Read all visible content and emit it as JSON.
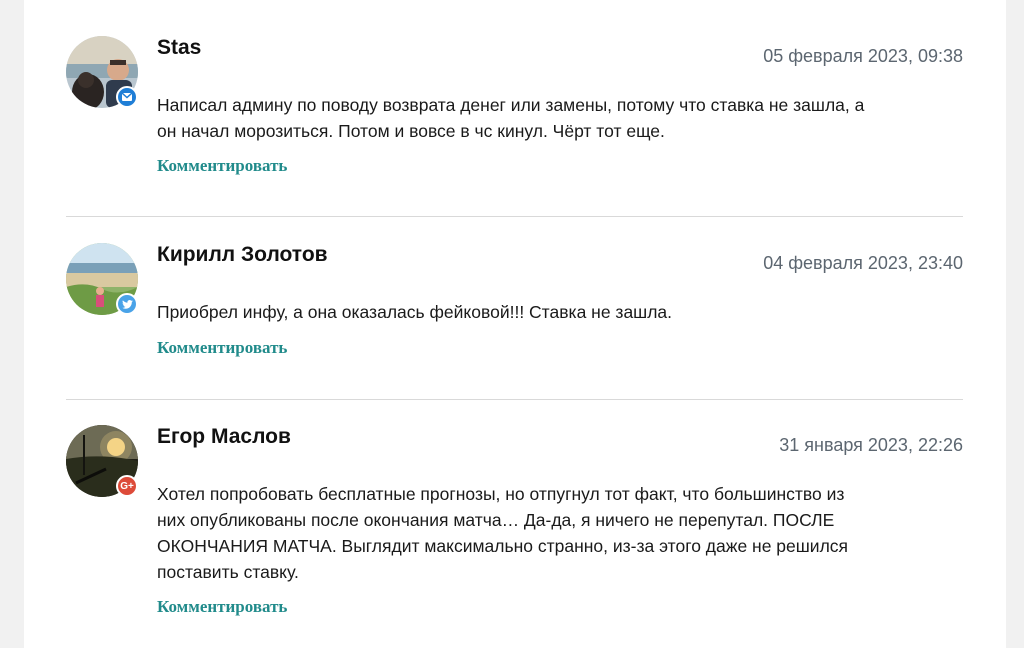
{
  "comments": [
    {
      "author": "Stas",
      "date": "05 февраля 2023, 09:38",
      "text": "Написал админу по поводу возврата денег или замены, потому что ставка не зашла, а он начал морозиться. Потом и вовсе в чс кинул. Чёрт тот еще.",
      "reply_label": "Комментировать",
      "social_icon": "mail-icon",
      "social_color": "#1f7ed6"
    },
    {
      "author": "Кирилл Золотов",
      "date": "04 февраля 2023, 23:40",
      "text": "Приобрел инфу, а она оказалась фейковой!!! Ставка не зашла.",
      "reply_label": "Комментировать",
      "social_icon": "twitter-icon",
      "social_color": "#4aa3e8"
    },
    {
      "author": "Егор Маслов",
      "date": "31 января 2023, 22:26",
      "text": "Хотел попробовать бесплатные прогнозы, но отпугнул тот факт, что большинство из них опубликованы после окончания матча… Да-да, я ничего не перепутал. ПОСЛЕ ОКОНЧАНИЯ МАТЧА. Выглядит максимально странно, из-за этого даже не решился поставить ставку.",
      "reply_label": "Комментировать",
      "social_icon": "google-plus-icon",
      "social_label": "G+",
      "social_color": "#dd4b39"
    }
  ]
}
